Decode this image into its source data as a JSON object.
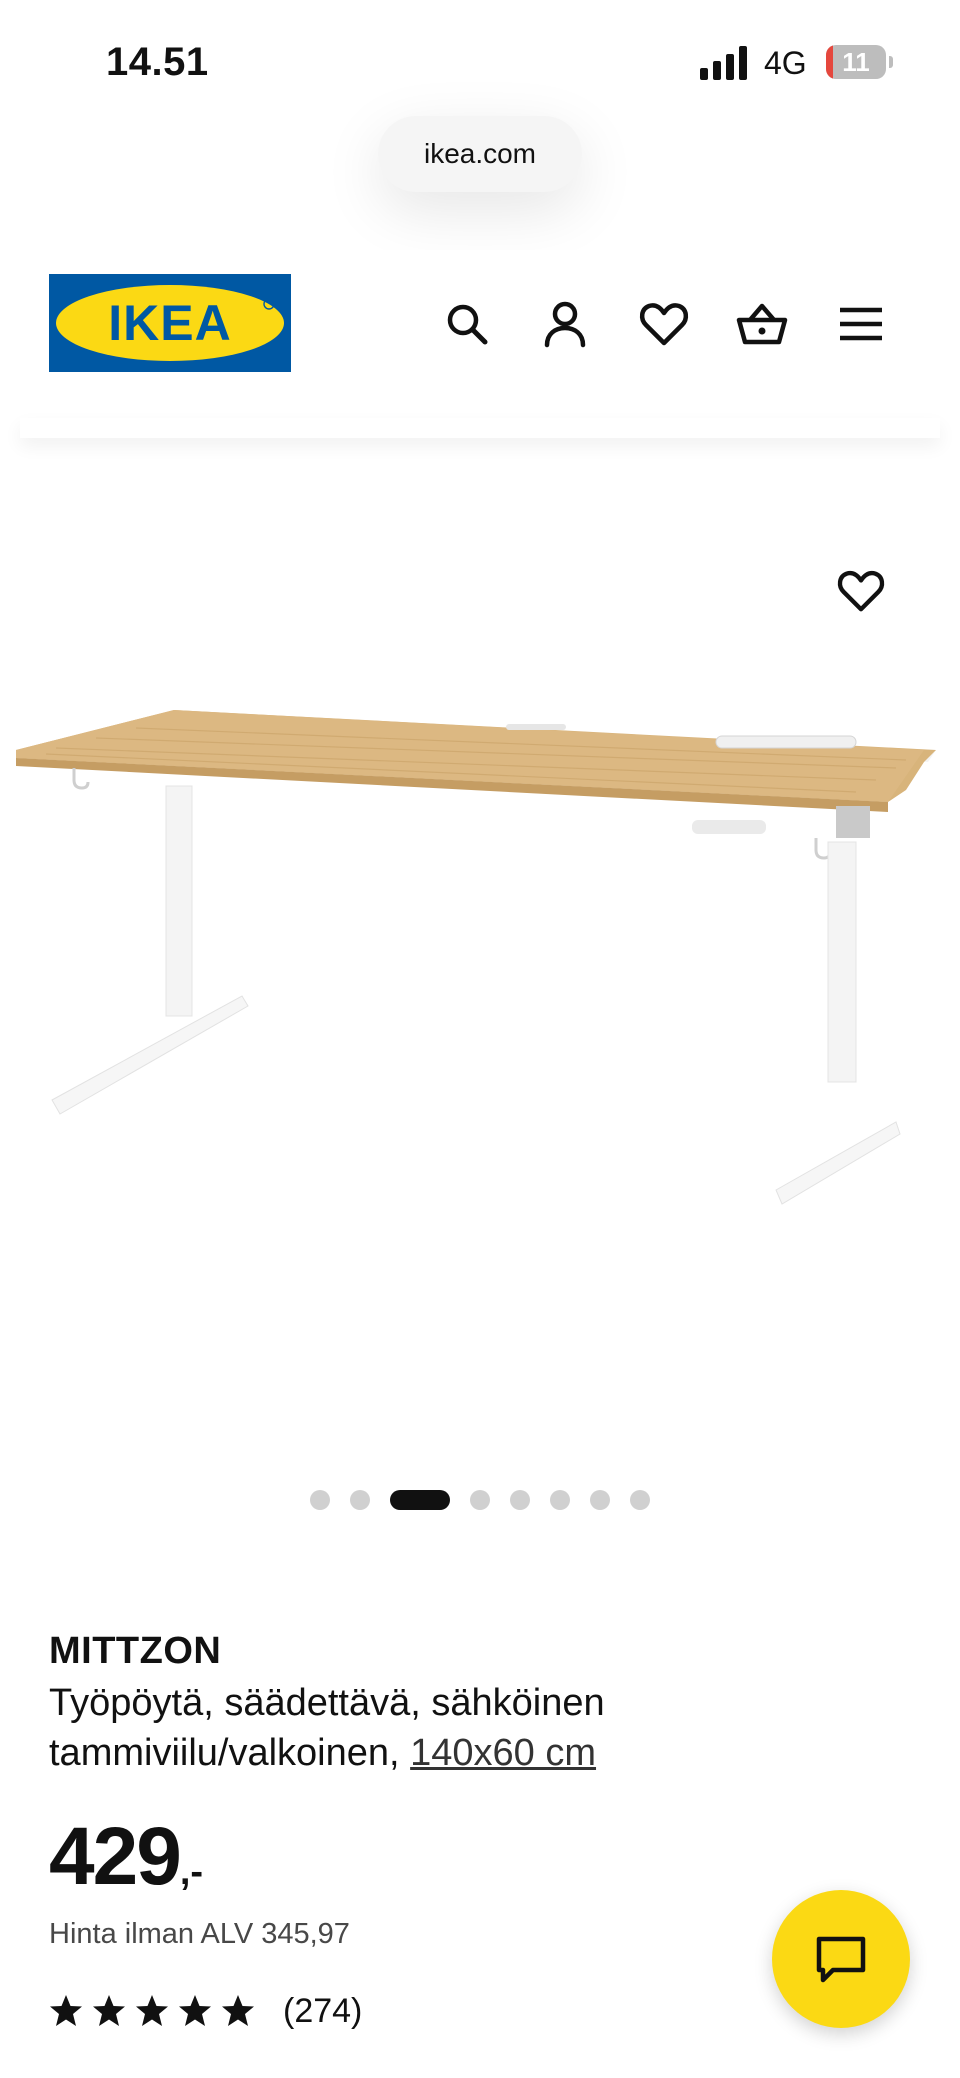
{
  "status_bar": {
    "time": "14.51",
    "network": "4G",
    "battery_level": "11",
    "battery_fraction": 0.11,
    "battery_color": "#e5473d"
  },
  "browser": {
    "url": "ikea.com"
  },
  "header": {
    "logo_text": "IKEA",
    "logo_colors": {
      "background": "#0058a3",
      "oval": "#fbd914",
      "text": "#0058a3"
    },
    "icons": [
      "search-icon",
      "account-icon",
      "favourites-icon",
      "cart-icon",
      "menu-icon"
    ]
  },
  "gallery": {
    "image_description_icon": "desk-image",
    "dot_count": 8,
    "active_dot_index": 2
  },
  "product": {
    "name": "MITTZON",
    "description_main": "Työpöytä, säädettävä, sähköinen tammiviilu/valkoinen, ",
    "size": "140x60 cm",
    "price_integer": "429",
    "price_suffix": ",-",
    "price_without_vat": "Hinta ilman ALV 345,97",
    "rating_stars": 5,
    "review_count": "(274)"
  },
  "chat": {
    "icon": "chat-icon",
    "color": "#fbd914"
  }
}
